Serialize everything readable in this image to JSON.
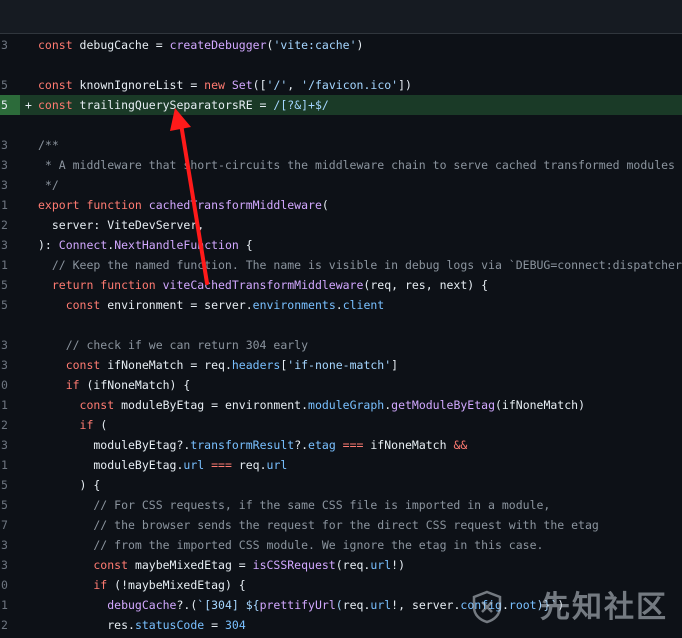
{
  "watermark": "先知社区",
  "lines": [
    {
      "num": "3",
      "marker": "",
      "added": false,
      "tokens": [
        [
          "k",
          "const "
        ],
        [
          "",
          "debugCache = "
        ],
        [
          "f",
          "createDebugger"
        ],
        [
          "",
          "("
        ],
        [
          "s",
          "'vite:cache'"
        ],
        [
          "",
          ")"
        ]
      ]
    },
    {
      "num": "",
      "marker": "",
      "added": false,
      "tokens": []
    },
    {
      "num": "5",
      "marker": "",
      "added": false,
      "tokens": [
        [
          "k",
          "const "
        ],
        [
          "",
          "knownIgnoreList = "
        ],
        [
          "k",
          "new "
        ],
        [
          "f",
          "Set"
        ],
        [
          "",
          "(["
        ],
        [
          "s",
          "'/'"
        ],
        [
          "",
          ", "
        ],
        [
          "s",
          "'/favicon.ico'"
        ],
        [
          "",
          "])"
        ]
      ]
    },
    {
      "num": "5",
      "marker": "+",
      "added": true,
      "tokens": [
        [
          "k",
          "const "
        ],
        [
          "",
          "trailingQuerySeparatorsRE = "
        ],
        [
          "s",
          "/[?&]+$/"
        ]
      ]
    },
    {
      "num": "",
      "marker": "",
      "added": false,
      "tokens": []
    },
    {
      "num": "3",
      "marker": "",
      "added": false,
      "tokens": [
        [
          "c",
          "/**"
        ]
      ]
    },
    {
      "num": "3",
      "marker": "",
      "added": false,
      "tokens": [
        [
          "c",
          " * A middleware that short-circuits the middleware chain to serve cached transformed modules"
        ]
      ]
    },
    {
      "num": "3",
      "marker": "",
      "added": false,
      "tokens": [
        [
          "c",
          " */"
        ]
      ]
    },
    {
      "num": "1",
      "marker": "",
      "added": false,
      "tokens": [
        [
          "k",
          "export function "
        ],
        [
          "f",
          "cachedTransformMiddleware"
        ],
        [
          "",
          "("
        ]
      ]
    },
    {
      "num": "2",
      "marker": "",
      "added": false,
      "tokens": [
        [
          "",
          "  server: ViteDevServer,"
        ]
      ]
    },
    {
      "num": "3",
      "marker": "",
      "added": false,
      "tokens": [
        [
          "",
          "): "
        ],
        [
          "f",
          "Connect"
        ],
        [
          "",
          "."
        ],
        [
          "f",
          "NextHandleFunction"
        ],
        [
          "",
          " {"
        ]
      ]
    },
    {
      "num": "1",
      "marker": "",
      "added": false,
      "tokens": [
        [
          "c",
          "  // Keep the named function. The name is visible in debug logs via `DEBUG=connect:dispatcher ...`"
        ]
      ]
    },
    {
      "num": "5",
      "marker": "",
      "added": false,
      "tokens": [
        [
          "k",
          "  return function "
        ],
        [
          "f",
          "viteCachedTransformMiddleware"
        ],
        [
          "",
          "(req, res, next) {"
        ]
      ]
    },
    {
      "num": "5",
      "marker": "",
      "added": false,
      "tokens": [
        [
          "k",
          "    const "
        ],
        [
          "",
          "environment = server."
        ],
        [
          "p",
          "environments"
        ],
        [
          "",
          "."
        ],
        [
          "p",
          "client"
        ]
      ]
    },
    {
      "num": "",
      "marker": "",
      "added": false,
      "tokens": []
    },
    {
      "num": "3",
      "marker": "",
      "added": false,
      "tokens": [
        [
          "c",
          "    // check if we can return 304 early"
        ]
      ]
    },
    {
      "num": "3",
      "marker": "",
      "added": false,
      "tokens": [
        [
          "k",
          "    const "
        ],
        [
          "",
          "ifNoneMatch = req."
        ],
        [
          "p",
          "headers"
        ],
        [
          "",
          "["
        ],
        [
          "s",
          "'if-none-match'"
        ],
        [
          "",
          "]"
        ]
      ]
    },
    {
      "num": "0",
      "marker": "",
      "added": false,
      "tokens": [
        [
          "k",
          "    if "
        ],
        [
          "",
          "(ifNoneMatch) {"
        ]
      ]
    },
    {
      "num": "1",
      "marker": "",
      "added": false,
      "tokens": [
        [
          "k",
          "      const "
        ],
        [
          "",
          "moduleByEtag = environment."
        ],
        [
          "p",
          "moduleGraph"
        ],
        [
          "",
          "."
        ],
        [
          "f",
          "getModuleByEtag"
        ],
        [
          "",
          "(ifNoneMatch)"
        ]
      ]
    },
    {
      "num": "2",
      "marker": "",
      "added": false,
      "tokens": [
        [
          "k",
          "      if "
        ],
        [
          "",
          "("
        ]
      ]
    },
    {
      "num": "3",
      "marker": "",
      "added": false,
      "tokens": [
        [
          "",
          "        moduleByEtag?."
        ],
        [
          "p",
          "transformResult"
        ],
        [
          "",
          "?."
        ],
        [
          "p",
          "etag"
        ],
        [
          "k",
          " === "
        ],
        [
          "",
          "ifNoneMatch "
        ],
        [
          "k",
          "&&"
        ]
      ]
    },
    {
      "num": "1",
      "marker": "",
      "added": false,
      "tokens": [
        [
          "",
          "        moduleByEtag."
        ],
        [
          "p",
          "url"
        ],
        [
          "k",
          " === "
        ],
        [
          "",
          "req."
        ],
        [
          "p",
          "url"
        ]
      ]
    },
    {
      "num": "5",
      "marker": "",
      "added": false,
      "tokens": [
        [
          "",
          "      ) {"
        ]
      ]
    },
    {
      "num": "5",
      "marker": "",
      "added": false,
      "tokens": [
        [
          "c",
          "        // For CSS requests, if the same CSS file is imported in a module,"
        ]
      ]
    },
    {
      "num": "7",
      "marker": "",
      "added": false,
      "tokens": [
        [
          "c",
          "        // the browser sends the request for the direct CSS request with the etag"
        ]
      ]
    },
    {
      "num": "3",
      "marker": "",
      "added": false,
      "tokens": [
        [
          "c",
          "        // from the imported CSS module. We ignore the etag in this case."
        ]
      ]
    },
    {
      "num": "3",
      "marker": "",
      "added": false,
      "tokens": [
        [
          "k",
          "        const "
        ],
        [
          "",
          "maybeMixedEtag = "
        ],
        [
          "f",
          "isCSSRequest"
        ],
        [
          "",
          "(req."
        ],
        [
          "p",
          "url"
        ],
        [
          "",
          "!)"
        ]
      ]
    },
    {
      "num": "0",
      "marker": "",
      "added": false,
      "tokens": [
        [
          "k",
          "        if "
        ],
        [
          "",
          "(!maybeMixedEtag) {"
        ]
      ]
    },
    {
      "num": "1",
      "marker": "",
      "added": false,
      "tokens": [
        [
          "f",
          "          debugCache"
        ],
        [
          "",
          "?.("
        ],
        [
          "s",
          "`[304] ${"
        ],
        [
          "f",
          "prettifyUrl"
        ],
        [
          "s",
          "("
        ],
        [
          "",
          "req."
        ],
        [
          "p",
          "url"
        ],
        [
          "",
          "!, server."
        ],
        [
          "p",
          "config"
        ],
        [
          "",
          "."
        ],
        [
          "p",
          "root"
        ],
        [
          "s",
          ")}`"
        ],
        [
          "",
          ")"
        ]
      ]
    },
    {
      "num": "2",
      "marker": "",
      "added": false,
      "tokens": [
        [
          "",
          "          res."
        ],
        [
          "p",
          "statusCode"
        ],
        [
          "",
          " = "
        ],
        [
          "p",
          "304"
        ]
      ]
    }
  ]
}
